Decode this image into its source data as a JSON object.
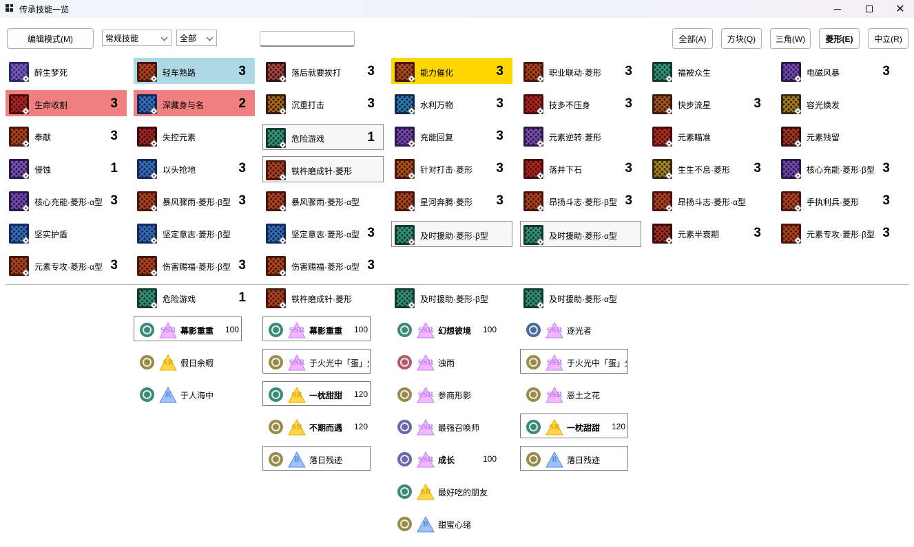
{
  "window": {
    "title": "传承技能一览"
  },
  "toolbar": {
    "edit_mode_label": "编辑模式(M)",
    "skill_type_value": "常规技能",
    "scope_value": "全部",
    "search_value": "",
    "filter_all": "全部(A)",
    "filter_square": "方块(Q)",
    "filter_triangle": "三角(W)",
    "filter_diamond": "菱形(E)",
    "filter_neutral": "中立(R)"
  },
  "skills": [
    {
      "label": "醉生梦死",
      "level": "",
      "color": "#2a2b6e",
      "pattern": "#c47cff"
    },
    {
      "label": "轻车熟路",
      "level": "3",
      "color": "#4a160d",
      "pattern": "#ff6a2a",
      "state": "sel-blue"
    },
    {
      "label": "落后就要挨打",
      "level": "3",
      "color": "#3a1414",
      "pattern": "#ff6a6a"
    },
    {
      "label": "能力催化",
      "level": "3",
      "color": "#4a160d",
      "pattern": "#ff7a2a",
      "state": "sel-gold"
    },
    {
      "label": "职业联动·菱形",
      "level": "3",
      "color": "#4a160d",
      "pattern": "#ff6a2a"
    },
    {
      "label": "福被众生",
      "level": "",
      "color": "#113a30",
      "pattern": "#4fe0b0"
    },
    {
      "label": "电磁风暴",
      "level": "3",
      "color": "#2a1a4e",
      "pattern": "#b46cff"
    },
    {
      "label": "生命收割",
      "level": "3",
      "color": "#4a0d0d",
      "pattern": "#ff3a3a",
      "state": "sel-red"
    },
    {
      "label": "深藏身与名",
      "level": "2",
      "color": "#0e2a5e",
      "pattern": "#5aa8ff",
      "state": "sel-red"
    },
    {
      "label": "沉重打击",
      "level": "3",
      "color": "#3a1a0a",
      "pattern": "#ffb02a"
    },
    {
      "label": "水利万物",
      "level": "3",
      "color": "#0e2a4e",
      "pattern": "#4ac0ff"
    },
    {
      "label": "技多不压身",
      "level": "3",
      "color": "#4a0d0d",
      "pattern": "#ff3a3a"
    },
    {
      "label": "快步流星",
      "level": "3",
      "color": "#3a1a0a",
      "pattern": "#ff8a2a"
    },
    {
      "label": "容光焕发",
      "level": "",
      "color": "#3a2a0a",
      "pattern": "#ffc43a"
    },
    {
      "label": "奉献",
      "level": "3",
      "color": "#4a160d",
      "pattern": "#ff6a2a"
    },
    {
      "label": "失控元素",
      "level": "",
      "color": "#3a0d0d",
      "pattern": "#ff3a3a"
    },
    {
      "label": "危险游戏",
      "level": "1",
      "color": "#113a30",
      "pattern": "#4fe0b0",
      "state": "framed"
    },
    {
      "label": "充能回复",
      "level": "3",
      "color": "#2a1a4e",
      "pattern": "#b46cff"
    },
    {
      "label": "元素逆转·菱形",
      "level": "",
      "color": "#2a1a4e",
      "pattern": "#c47cff"
    },
    {
      "label": "元素瞄准",
      "level": "",
      "color": "#4a0d0d",
      "pattern": "#ff4a3a"
    },
    {
      "label": "元素残留",
      "level": "",
      "color": "#3a0d0d",
      "pattern": "#ff5a3a"
    },
    {
      "label": "侵蚀",
      "level": "1",
      "color": "#2a1a4e",
      "pattern": "#c47cff"
    },
    {
      "label": "以头抢地",
      "level": "3",
      "color": "#0e2a5e",
      "pattern": "#5aa8ff"
    },
    {
      "label": "铁杵磨成针·菱形",
      "level": "",
      "color": "#4a160d",
      "pattern": "#ff6a2a",
      "state": "framed"
    },
    {
      "label": "针对打击·菱形",
      "level": "3",
      "color": "#4a160d",
      "pattern": "#ff8a2a"
    },
    {
      "label": "落井下石",
      "level": "3",
      "color": "#4a0d0d",
      "pattern": "#ff3a3a"
    },
    {
      "label": "生生不息·菱形",
      "level": "3",
      "color": "#3a2a0a",
      "pattern": "#ffd43a"
    },
    {
      "label": "核心充能·菱形·β型",
      "level": "3",
      "color": "#2a1a4e",
      "pattern": "#b46cff"
    },
    {
      "label": "核心充能·菱形·α型",
      "level": "3",
      "color": "#2a1a4e",
      "pattern": "#b46cff"
    },
    {
      "label": "暴风骤雨·菱形·β型",
      "level": "3",
      "color": "#4a160d",
      "pattern": "#ff6a2a"
    },
    {
      "label": "暴风骤雨·菱形·α型",
      "level": "",
      "color": "#4a160d",
      "pattern": "#ff6a2a"
    },
    {
      "label": "星河奔腾·菱形",
      "level": "3",
      "color": "#4a160d",
      "pattern": "#ff6a2a"
    },
    {
      "label": "昂扬斗志·菱形·β型",
      "level": "3",
      "color": "#4a160d",
      "pattern": "#ff6a2a"
    },
    {
      "label": "昂扬斗志·菱形·α型",
      "level": "",
      "color": "#4a160d",
      "pattern": "#ff6a2a"
    },
    {
      "label": "手执利兵·菱形",
      "level": "3",
      "color": "#4a160d",
      "pattern": "#ff6a2a"
    },
    {
      "label": "坚实护盾",
      "level": "",
      "color": "#0e2a5e",
      "pattern": "#5aa8ff"
    },
    {
      "label": "坚定意志·菱形·β型",
      "level": "",
      "color": "#0e2a5e",
      "pattern": "#5aa8ff"
    },
    {
      "label": "坚定意志·菱形·α型",
      "level": "3",
      "color": "#0e2a5e",
      "pattern": "#5aa8ff"
    },
    {
      "label": "及时援助·菱形·β型",
      "level": "",
      "color": "#113a30",
      "pattern": "#4fe0b0",
      "state": "framed"
    },
    {
      "label": "及时援助·菱形·α型",
      "level": "",
      "color": "#113a30",
      "pattern": "#4fe0b0",
      "state": "framed"
    },
    {
      "label": "元素半衰期",
      "level": "3",
      "color": "#3a0d0d",
      "pattern": "#ff4a3a"
    },
    {
      "label": "元素专攻·菱形·β型",
      "level": "3",
      "color": "#4a160d",
      "pattern": "#ff6a2a"
    },
    {
      "label": "元素专攻·菱形·α型",
      "level": "3",
      "color": "#4a160d",
      "pattern": "#ff6a2a"
    },
    {
      "label": "伤害赐福·菱形·β型",
      "level": "3",
      "color": "#4a160d",
      "pattern": "#ff6a2a"
    },
    {
      "label": "伤害赐福·菱形·α型",
      "level": "3",
      "color": "#4a160d",
      "pattern": "#ff6a2a"
    }
  ],
  "detail_columns": [
    {
      "skill": {
        "label": "危险游戏",
        "level": "1",
        "color": "#113a30",
        "pattern": "#4fe0b0"
      },
      "cards": [
        {
          "name": "幕影重重",
          "rarity": "SSR",
          "value": "100",
          "type": "green",
          "bold": true,
          "framed": true
        },
        {
          "name": "假日余暇",
          "rarity": "SR",
          "value": "",
          "type": "gold"
        },
        {
          "name": "于人海中",
          "rarity": "R",
          "value": "",
          "type": "green"
        }
      ]
    },
    {
      "skill": {
        "label": "铁杵磨成针·菱形",
        "level": "",
        "color": "#4a160d",
        "pattern": "#ff6a2a"
      },
      "cards": [
        {
          "name": "幕影重重",
          "rarity": "SSR",
          "value": "100",
          "type": "green",
          "bold": true,
          "framed": true
        },
        {
          "name": "于火光中「蛋」分",
          "rarity": "SSR",
          "value": "",
          "type": "gold",
          "framed": true
        },
        {
          "name": "一枕甜甜",
          "rarity": "SR",
          "value": "120",
          "type": "green",
          "bold": true,
          "framed": true
        },
        {
          "name": "不期而遇",
          "rarity": "SR",
          "value": "120",
          "type": "gold",
          "bold": true
        },
        {
          "name": "落日残迹",
          "rarity": "R",
          "value": "",
          "type": "gold",
          "framed": true
        }
      ]
    },
    {
      "skill": {
        "label": "及时援助·菱形·β型",
        "level": "",
        "color": "#113a30",
        "pattern": "#4fe0b0"
      },
      "cards": [
        {
          "name": "幻想彼境",
          "rarity": "SSR",
          "value": "100",
          "type": "green",
          "bold": true
        },
        {
          "name": "浊雨",
          "rarity": "SSR",
          "value": "",
          "type": "red"
        },
        {
          "name": "参商形影",
          "rarity": "SSR",
          "value": "",
          "type": "gold"
        },
        {
          "name": "最强召唤师",
          "rarity": "SSR",
          "value": "",
          "type": "purple"
        },
        {
          "name": "成长",
          "rarity": "SSR",
          "value": "100",
          "type": "purple",
          "bold": true
        },
        {
          "name": "最好吃的朋友",
          "rarity": "SR",
          "value": "",
          "type": "green"
        },
        {
          "name": "甜蜜心绪",
          "rarity": "R",
          "value": "",
          "type": "gold"
        }
      ]
    },
    {
      "skill": {
        "label": "及时援助·菱形·α型",
        "level": "",
        "color": "#113a30",
        "pattern": "#4fe0b0"
      },
      "cards": [
        {
          "name": "逐光者",
          "rarity": "SSR",
          "value": "",
          "type": "blue"
        },
        {
          "name": "于火光中「蛋」分",
          "rarity": "SSR",
          "value": "",
          "type": "gold",
          "framed": true
        },
        {
          "name": "恶土之花",
          "rarity": "SSR",
          "value": "",
          "type": "gold"
        },
        {
          "name": "一枕甜甜",
          "rarity": "SR",
          "value": "120",
          "type": "green",
          "bold": true,
          "framed": true
        },
        {
          "name": "落日残迹",
          "rarity": "R",
          "value": "",
          "type": "gold",
          "framed": true
        }
      ]
    }
  ],
  "icons": {
    "app": "app-grid-icon",
    "minimize": "minimize-icon",
    "maximize": "maximize-icon",
    "close": "close-icon",
    "dropdown": "chevron-down-icon"
  }
}
